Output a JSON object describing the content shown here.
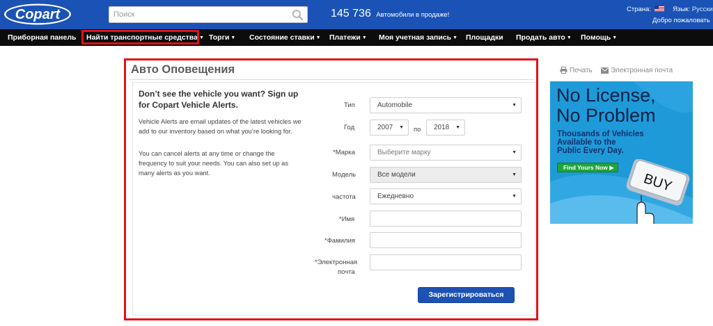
{
  "header": {
    "logo_text": "Copart",
    "search_placeholder": "Поиск",
    "vehicle_count": "145 736",
    "vehicle_count_suffix": "Автомобили в продаже!",
    "country_label": "Страна:",
    "language_label": "Язык:",
    "language_value": "Русский",
    "welcome_text": "Добро пожаловать"
  },
  "nav": {
    "items": [
      {
        "label": "Приборная панель",
        "has_caret": false
      },
      {
        "label": "Найти транспортные средства",
        "has_caret": true,
        "highlighted": true
      },
      {
        "label": "Торги",
        "has_caret": true
      },
      {
        "label": "Состояние ставки",
        "has_caret": true
      },
      {
        "label": "Платежи",
        "has_caret": true
      },
      {
        "label": "Моя учетная запись",
        "has_caret": true
      },
      {
        "label": "Площадки",
        "has_caret": false
      },
      {
        "label": "Продать авто",
        "has_caret": true
      },
      {
        "label": "Помощь",
        "has_caret": true
      }
    ]
  },
  "panel": {
    "title": "Авто Оповещения",
    "intro_title": "Don’t see the vehicle you want? Sign up for Copart Vehicle Alerts.",
    "intro_p1": "Vehicle Alerts are email updates of the latest vehicles we add to our inventory based on what you’re looking for.",
    "intro_p2": "You can cancel alerts at any time or change the frequency to suit your needs. You can also set up as many alerts as you want."
  },
  "form": {
    "type_label": "Тип",
    "type_value": "Automobile",
    "year_label": "Год",
    "year_from": "2007",
    "year_to_label": "по",
    "year_to": "2018",
    "make_label": "*Марка",
    "make_value": "Выберите марку",
    "model_label": "Модель",
    "model_value": "Все модели",
    "frequency_label": "частота",
    "frequency_value": "Ежедневно",
    "first_name_label": "*Имя",
    "last_name_label": "*Фамилия",
    "email_label_line1": "*Электронная",
    "email_label_line2": "почта",
    "submit_label": "Зарегистрироваться"
  },
  "side": {
    "print_label": "Печать",
    "email_label": "Электронная почта",
    "ad": {
      "headline_1": "No License,",
      "headline_2": "No Problem",
      "sub_1": "Thousands of Vehicles",
      "sub_2": "Available to the",
      "sub_3": "Public Every Day.",
      "button": "Find Yours Now",
      "key_text": "BUY"
    }
  },
  "colors": {
    "header_blue": "#1a53b5",
    "nav_black": "#0c0c0c",
    "highlight_red": "#e01218",
    "button_blue": "#1d52b3",
    "ad_blue": "#1f9ad9"
  }
}
